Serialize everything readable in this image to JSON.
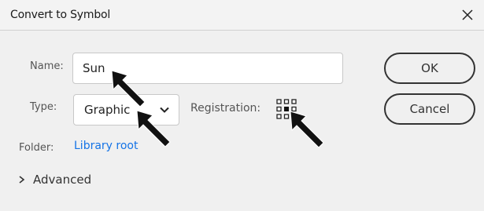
{
  "dialog": {
    "title": "Convert to Symbol",
    "close_icon": "close-icon"
  },
  "form": {
    "name_label": "Name:",
    "name_value": "Sun",
    "type_label": "Type:",
    "type_value": "Graphic",
    "registration_label": "Registration:",
    "folder_label": "Folder:",
    "folder_value": "Library root",
    "advanced_label": "Advanced"
  },
  "buttons": {
    "ok_label": "OK",
    "cancel_label": "Cancel"
  },
  "colors": {
    "link": "#1473e6",
    "annotation_arrow": "#000000"
  }
}
